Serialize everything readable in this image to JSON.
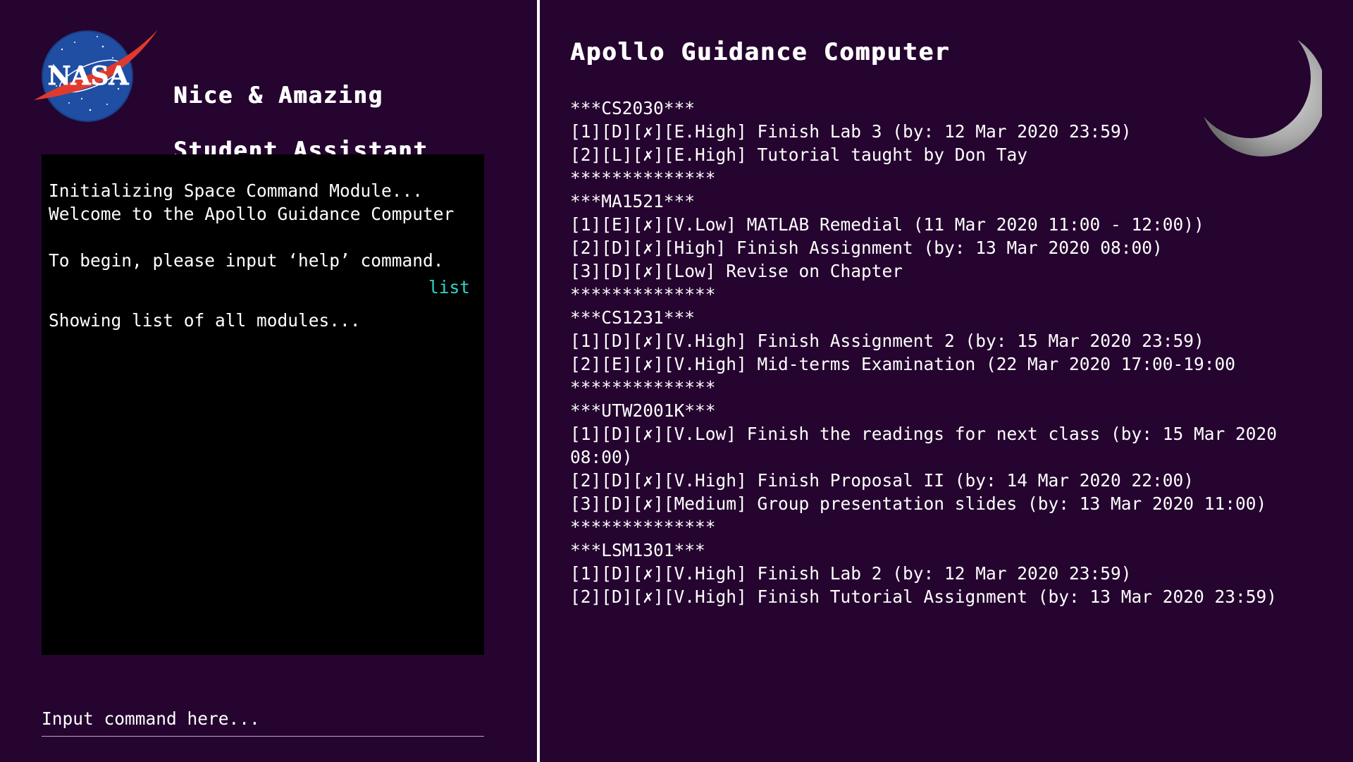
{
  "logo": {
    "text": "NASA",
    "icon": "nasa-logo-icon"
  },
  "app_title": {
    "line1": "Nice & Amazing",
    "line2": "Student Assistant"
  },
  "console": {
    "lines": [
      "Initializing Space Command Module...",
      "Welcome to the Apollo Guidance Computer",
      "To begin, please input ‘help’ command."
    ],
    "user_command": "list",
    "response": "Showing list of all modules..."
  },
  "input": {
    "placeholder": "Input command here..."
  },
  "list_panel": {
    "title": "Apollo Guidance Computer",
    "moon_icon": "crescent-moon-icon",
    "lines": [
      "***CS2030***",
      "[1][D][✗][E.High] Finish Lab 3 (by: 12 Mar 2020 23:59)",
      "[2][L][✗][E.High] Tutorial taught by Don Tay",
      "**************",
      "***MA1521***",
      "[1][E][✗][V.Low] MATLAB Remedial (11 Mar 2020 11:00 - 12:00))",
      "[2][D][✗][High] Finish Assignment (by: 13 Mar 2020 08:00)",
      "[3][D][✗][Low] Revise on Chapter",
      "**************",
      "***CS1231***",
      "[1][D][✗][V.High] Finish Assignment 2 (by: 15 Mar 2020 23:59)",
      "[2][E][✗][V.High] Mid-terms Examination (22 Mar 2020 17:00-19:00",
      "**************",
      "***UTW2001K***",
      "[1][D][✗][V.Low] Finish the readings for next class (by: 15 Mar 2020",
      "08:00)",
      "[2][D][✗][V.High] Finish Proposal II (by: 14 Mar 2020 22:00)",
      "[3][D][✗][Medium] Group presentation slides (by: 13 Mar 2020 11:00)",
      "**************",
      "***LSM1301***",
      "[1][D][✗][V.High] Finish Lab 2 (by: 12 Mar 2020 23:59)",
      "[2][D][✗][V.High] Finish Tutorial Assignment (by: 13 Mar 2020 23:59)"
    ]
  },
  "colors": {
    "background": "#25042f",
    "console_bg": "#000000",
    "command_accent": "#2ed8c3",
    "text": "#ffffff"
  }
}
